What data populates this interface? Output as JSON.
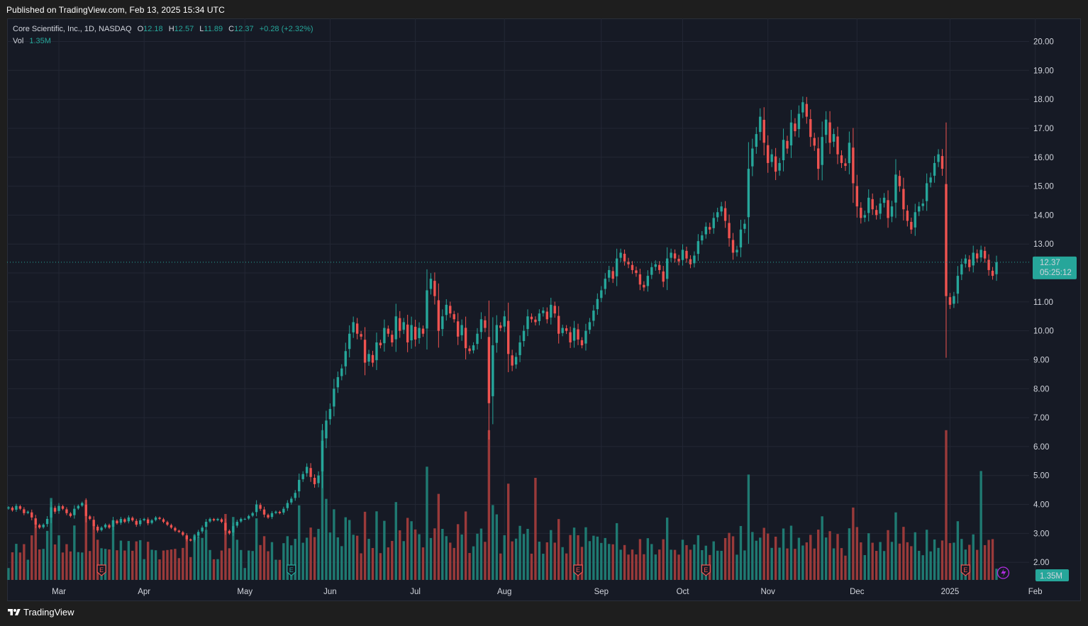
{
  "header": {
    "published": "Published on TradingView.com, Feb 13, 2025 15:34 UTC"
  },
  "legend": {
    "symbol": "Core Scientific, Inc., 1D, NASDAQ",
    "open_label": "O",
    "open": "12.18",
    "high_label": "H",
    "high": "12.57",
    "low_label": "L",
    "low": "11.89",
    "close_label": "C",
    "close": "12.37",
    "change": "+0.28 (+2.32%)",
    "vol_label": "Vol",
    "vol": "1.35M"
  },
  "last_price": {
    "price": "12.37",
    "countdown": "05:25:12"
  },
  "volume_badge": "1.35M",
  "footer": {
    "brand": "TradingView"
  },
  "colors": {
    "up": "#26a69a",
    "down": "#ef5350",
    "up_vol": "#1f7a72",
    "down_vol": "#9a3a3a",
    "background": "#161a25",
    "grid": "#232734",
    "earnings_badge": "#ef5350",
    "dividend_badge": "#26a69a",
    "split_icon": "#b12de0"
  },
  "chart_data": {
    "type": "candlestick",
    "price_axis": {
      "ticks": [
        "20.00",
        "19.00",
        "18.00",
        "17.00",
        "16.00",
        "15.00",
        "14.00",
        "13.00",
        "12.00",
        "11.00",
        "10.00",
        "9.00",
        "8.00",
        "7.00",
        "6.00",
        "5.00",
        "4.00",
        "3.00",
        "2.00"
      ],
      "ylim": [
        1.0,
        20.6
      ],
      "side": "right"
    },
    "time_axis": {
      "ticks": [
        "Mar",
        "Apr",
        "May",
        "Jun",
        "Jul",
        "Aug",
        "Sep",
        "Oct",
        "Nov",
        "Dec",
        "2025",
        "Feb"
      ]
    },
    "grid": true,
    "closes": [
      3.9,
      3.8,
      3.95,
      3.85,
      3.7,
      3.75,
      3.55,
      3.3,
      3.2,
      3.3,
      3.5,
      3.9,
      3.75,
      3.95,
      3.85,
      3.7,
      3.6,
      3.85,
      3.95,
      4.05,
      3.6,
      3.5,
      3.25,
      3.1,
      3.2,
      3.3,
      3.2,
      3.45,
      3.35,
      3.5,
      3.4,
      3.55,
      3.45,
      3.3,
      3.45,
      3.5,
      3.35,
      3.45,
      3.55,
      3.5,
      3.4,
      3.3,
      3.2,
      3.1,
      3.05,
      2.95,
      2.8,
      2.75,
      2.9,
      3.05,
      3.2,
      3.4,
      3.5,
      3.45,
      3.5,
      3.4,
      3.1,
      3.0,
      3.25,
      3.4,
      3.5,
      3.5,
      3.6,
      3.7,
      4.0,
      3.85,
      3.65,
      3.55,
      3.7,
      3.75,
      3.7,
      3.85,
      4.05,
      4.2,
      4.4,
      4.85,
      5.05,
      5.3,
      4.95,
      4.7,
      5.0,
      6.2,
      6.9,
      7.3,
      8.0,
      8.4,
      8.7,
      9.3,
      9.9,
      10.3,
      9.9,
      9.8,
      8.9,
      9.2,
      8.9,
      9.6,
      9.5,
      10.1,
      9.9,
      9.6,
      10.5,
      10.0,
      10.3,
      9.6,
      10.2,
      9.7,
      10.1,
      9.9,
      11.4,
      11.8,
      11.2,
      10.0,
      10.5,
      10.9,
      10.6,
      10.4,
      9.8,
      10.2,
      9.4,
      9.3,
      9.5,
      9.9,
      10.4,
      10.1,
      7.5,
      9.5,
      10.2,
      10.1,
      10.5,
      9.2,
      8.8,
      9.1,
      9.6,
      10.0,
      10.5,
      10.4,
      10.3,
      10.6,
      10.7,
      10.4,
      10.9,
      10.6,
      9.9,
      10.1,
      10.0,
      9.6,
      10.1,
      9.7,
      9.5,
      10.0,
      10.3,
      10.7,
      11.1,
      11.4,
      11.8,
      12.1,
      11.8,
      12.5,
      12.7,
      12.4,
      12.3,
      12.1,
      12.0,
      11.6,
      11.5,
      11.9,
      12.2,
      12.3,
      12.1,
      11.7,
      12.5,
      12.7,
      12.5,
      12.4,
      12.8,
      12.5,
      12.3,
      12.6,
      13.1,
      13.3,
      13.6,
      13.5,
      13.9,
      14.1,
      14.3,
      13.8,
      13.2,
      12.7,
      12.8,
      13.5,
      13.7,
      15.6,
      16.3,
      16.8,
      17.4,
      16.5,
      15.8,
      16.1,
      15.5,
      15.8,
      16.6,
      16.3,
      17.2,
      16.9,
      17.5,
      17.9,
      17.4,
      16.7,
      16.4,
      15.6,
      16.7,
      17.3,
      16.5,
      16.8,
      16.1,
      15.8,
      15.7,
      16.5,
      15.1,
      14.3,
      13.9,
      14.0,
      14.6,
      14.2,
      14.0,
      14.4,
      14.6,
      13.9,
      14.3,
      15.4,
      15.0,
      14.2,
      13.8,
      13.5,
      14.1,
      14.3,
      14.4,
      15.1,
      15.3,
      15.8,
      16.1,
      15.6,
      11.2,
      10.9,
      11.2,
      11.9,
      12.3,
      12.5,
      12.2,
      12.7,
      12.5,
      12.8,
      12.5,
      12.1,
      11.9,
      12.37
    ],
    "volume_ylim": [
      0,
      5.0
    ],
    "annotations": [
      "E",
      "E",
      "E",
      "E",
      "E"
    ]
  }
}
